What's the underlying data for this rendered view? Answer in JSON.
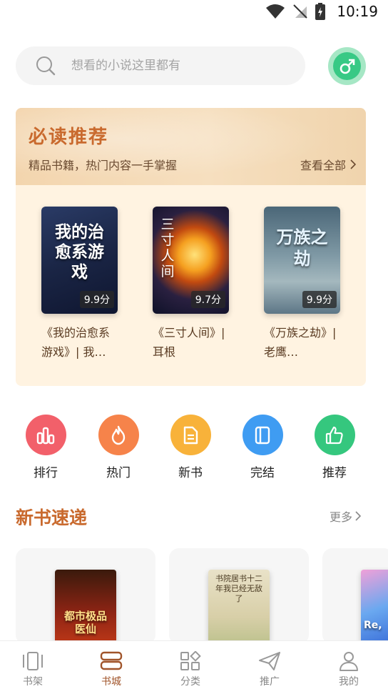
{
  "status_bar": {
    "time": "10:19"
  },
  "search": {
    "placeholder": "想看的小说这里都有"
  },
  "recommend": {
    "title": "必读推荐",
    "subtitle": "精品书籍，热门内容一手掌握",
    "view_all": "查看全部",
    "books": [
      {
        "name": "《我的治愈系游戏》| 我…",
        "score": "9.9分",
        "cover_text": "我的治愈系游戏",
        "cover_color": "#1e2a4a"
      },
      {
        "name": "《三寸人间》| 耳根",
        "score": "9.7分",
        "cover_text": "三寸人间",
        "cover_color": "#1a1d3a"
      },
      {
        "name": "《万族之劫》| 老鹰…",
        "score": "9.9分",
        "cover_text": "万族之劫",
        "cover_color": "#5b7a8a"
      }
    ]
  },
  "categories": [
    {
      "label": "排行",
      "icon": "chart-icon",
      "color": "#f2606a"
    },
    {
      "label": "热门",
      "icon": "fire-icon",
      "color": "#f6834a"
    },
    {
      "label": "新书",
      "icon": "document-icon",
      "color": "#f8b23a"
    },
    {
      "label": "完结",
      "icon": "book-icon",
      "color": "#3f9cf2"
    },
    {
      "label": "推荐",
      "icon": "thumb-up-icon",
      "color": "#35c77e"
    }
  ],
  "new_books": {
    "title": "新书速递",
    "more": "更多",
    "books": [
      {
        "cover_text": "都市极品医仙",
        "cover_color": "#7a1c10"
      },
      {
        "cover_text": "书院居书十二年我已经无敌了",
        "cover_color": "#d8d0b0"
      },
      {
        "cover_text": "Re,",
        "cover_color": "#3a7ad8"
      }
    ]
  },
  "bottom_nav": [
    {
      "label": "书架",
      "icon": "bookshelf-icon",
      "active": false
    },
    {
      "label": "书城",
      "icon": "bookstore-icon",
      "active": true
    },
    {
      "label": "分类",
      "icon": "category-icon",
      "active": false
    },
    {
      "label": "推广",
      "icon": "send-icon",
      "active": false
    },
    {
      "label": "我的",
      "icon": "user-icon",
      "active": false
    }
  ]
}
